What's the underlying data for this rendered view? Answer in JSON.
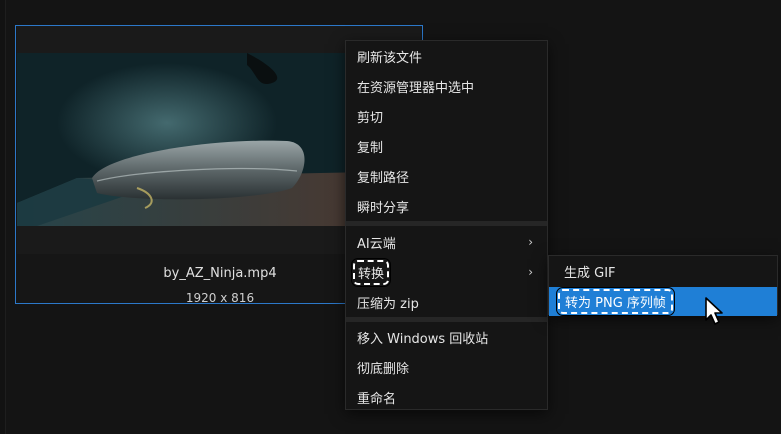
{
  "file_card": {
    "filename": "by_AZ_Ninja.mp4",
    "dimensions": "1920 x 816"
  },
  "context_menu": {
    "items": [
      {
        "label": "刷新该文件"
      },
      {
        "label": "在资源管理器中选中"
      },
      {
        "label": "剪切"
      },
      {
        "label": "复制"
      },
      {
        "label": "复制路径"
      },
      {
        "label": "瞬时分享"
      },
      {
        "label": "AI云端",
        "submenu_arrow": "›"
      },
      {
        "label": "转换",
        "submenu_arrow": "›"
      },
      {
        "label": "压缩为 zip"
      },
      {
        "label": "移入 Windows 回收站"
      },
      {
        "label": "彻底删除"
      },
      {
        "label": "重命名"
      }
    ]
  },
  "submenu": {
    "items": [
      {
        "label": "生成 GIF"
      },
      {
        "label": "转为 PNG 序列帧"
      }
    ]
  },
  "colors": {
    "background": "#141414",
    "menu_bg": "#151515",
    "accent": "#1f7fd6",
    "card_border": "#2c78c9"
  },
  "icons": {
    "cursor": "mouse-pointer-icon",
    "submenu_arrow": "chevron-right-icon"
  }
}
